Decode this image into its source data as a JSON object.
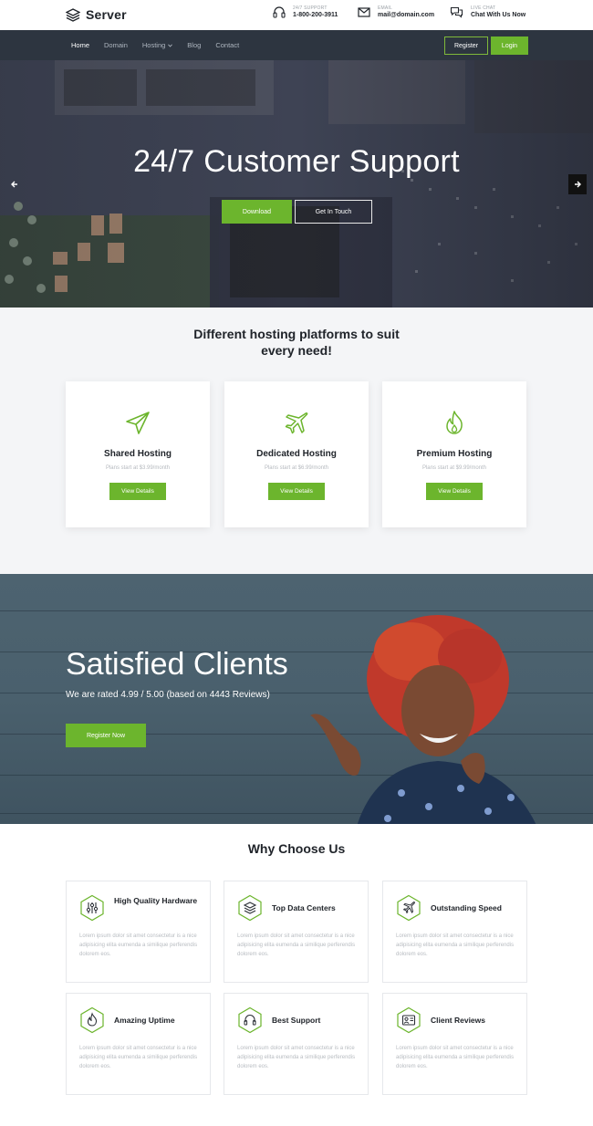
{
  "header": {
    "brand": "Server",
    "support": {
      "caption": "24/7 SUPPORT",
      "value": "1-800-200-3911"
    },
    "email": {
      "caption": "EMAIL",
      "value": "mail@domain.com"
    },
    "chat": {
      "caption": "LIVE CHAT",
      "value": "Chat With Us Now"
    }
  },
  "nav": {
    "items": [
      {
        "label": "Home",
        "active": true
      },
      {
        "label": "Domain",
        "active": false
      },
      {
        "label": "Hosting",
        "active": false,
        "has_dropdown": true
      },
      {
        "label": "Blog",
        "active": false
      },
      {
        "label": "Contact",
        "active": false
      }
    ],
    "register": "Register",
    "login": "Login"
  },
  "hero": {
    "title": "24/7 Customer Support",
    "download": "Download",
    "get_in_touch": "Get In Touch"
  },
  "platforms": {
    "title": "Different hosting platforms to suit every need!",
    "cards": [
      {
        "title": "Shared Hosting",
        "subtitle": "Plans start at $3.99/month",
        "button": "View Details",
        "icon": "paper-plane-icon"
      },
      {
        "title": "Dedicated Hosting",
        "subtitle": "Plans start at $6.99/month",
        "button": "View Details",
        "icon": "airplane-icon"
      },
      {
        "title": "Premium Hosting",
        "subtitle": "Plans start at $9.99/month",
        "button": "View Details",
        "icon": "flame-icon"
      }
    ]
  },
  "clients": {
    "title": "Satisfied Clients",
    "subtitle": "We are rated 4.99 / 5.00 (based on 4443 Reviews)",
    "button": "Register Now"
  },
  "why": {
    "title": "Why Choose Us",
    "features": [
      {
        "title": "High Quality Hardware",
        "icon": "sliders-icon",
        "desc": "Lorem ipsum dolor sit amet consectetur is a nice adipisicing elita eumenda a similique perferendis dolorem eos."
      },
      {
        "title": "Top Data Centers",
        "icon": "layers-icon",
        "desc": "Lorem ipsum dolor sit amet consectetur is a nice adipisicing elita eumenda a similique perferendis dolorem eos."
      },
      {
        "title": "Outstanding Speed",
        "icon": "airplane-icon",
        "desc": "Lorem ipsum dolor sit amet consectetur is a nice adipisicing elita eumenda a similique perferendis dolorem eos."
      },
      {
        "title": "Amazing Uptime",
        "icon": "flame-icon",
        "desc": "Lorem ipsum dolor sit amet consectetur is a nice adipisicing elita eumenda a similique perferendis dolorem eos."
      },
      {
        "title": "Best Support",
        "icon": "headset-icon",
        "desc": "Lorem ipsum dolor sit amet consectetur is a nice adipisicing elita eumenda a similique perferendis dolorem eos."
      },
      {
        "title": "Client Reviews",
        "icon": "user-card-icon",
        "desc": "Lorem ipsum dolor sit amet consectetur is a nice adipisicing elita eumenda a similique perferendis dolorem eos."
      }
    ]
  },
  "colors": {
    "accent": "#6cb52d",
    "nav_bg": "#2d3540",
    "text_dark": "#20242a"
  }
}
